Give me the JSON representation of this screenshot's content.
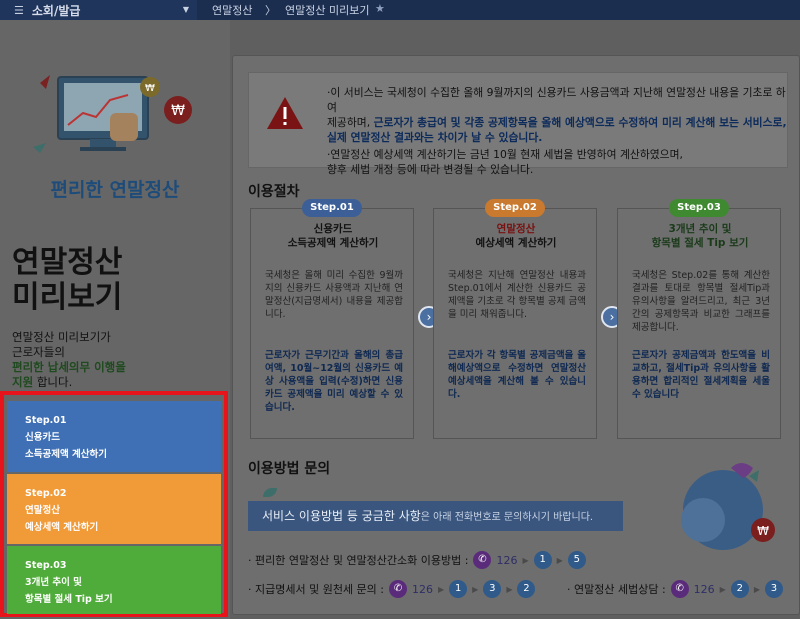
{
  "topbar": {
    "menu_icon": "hamburger-icon",
    "menu_label": "소회/발급",
    "breadcrumb": [
      "연말정산",
      "연말정산 미리보기"
    ],
    "favorite_icon": "star-icon"
  },
  "left": {
    "brand": "편리한 연말정산",
    "title_line1": "연말정산",
    "title_line2": "미리보기",
    "desc_line1": "연말정산 미리보기가",
    "desc_line2": "근로자들의",
    "desc_em": "편리한 납세의무 이행을",
    "desc_line4": "지원",
    "desc_line4_suffix": "합니다.",
    "steps": [
      {
        "label": "Step.01",
        "line1": "신용카드",
        "line2": "소득공제액 계산하기",
        "color": "#3f6fb4"
      },
      {
        "label": "Step.02",
        "line1": "연말정산",
        "line2": "예상세액 계산하기",
        "color": "#f19a38"
      },
      {
        "label": "Step.03",
        "line1": "3개년 추이 및",
        "line2": "항목별 절세 Tip 보기",
        "color": "#4fab3a"
      }
    ]
  },
  "notice": {
    "line1": "·이 서비스는 국세청이 수집한 올해 9월까지의 신용카드 사용금액과 지난해 연말정산 내용을 기초로 하여",
    "line2a": "제공하며, ",
    "line2b": "근로자가 총급여 및 각종 공제항목을 올해 예상액으로 수정하여 미리 계산해 보는 서비스로,",
    "line3": "실제 연말정산 결과와는 차이가 날 수 있습니다.",
    "line4": "·연말정산 예상세액 계산하기는 금년 10월 현재 세법을 반영하여 계산하였으며,",
    "line5": "향후 세법 개정 등에 따라 변경될 수 있습니다."
  },
  "procedure": {
    "title": "이용절차",
    "cards": [
      {
        "pill": "Step.01",
        "pill_color": "#3b5f96",
        "title1": "신용카드",
        "title2": "소득공제액 계산하기",
        "body": "국세청은 올해 미리 수집한 9월까지의 신용카드 사용액과 지난해 연말정산(지급명세서) 내용을 제공합니다.",
        "note": "근로자가 근무기간과 올해의 총급여액, 10월~12월의 신용카드 예상 사용액을 입력(수정)하면 신용카드 공제액을 미리 예상할 수 있습니다."
      },
      {
        "pill": "Step.02",
        "pill_color": "#c97a2e",
        "title1": "연말정산",
        "title2": "예상세액 계산하기",
        "body": "국세청은 지난해 연말정산 내용과 Step.01에서 계산한 신용카드 공제액을 기초로 각 항목별 공제 금액을 미리 채워줍니다.",
        "note": "근로자가 각 항목별 공제금액을 올해예상액으로 수정하면 연말정산 예상세액을 계산해 볼 수 있습니다."
      },
      {
        "pill": "Step.03",
        "pill_color": "#3f8a30",
        "title1": "3개년 추이 및",
        "title2": "항목별 절세 Tip 보기",
        "body": "국세청은 Step.02를 통해 계산한 결과를 토대로 항목별 절세Tip과 유의사항을 알려드리고, 최근 3년간의 공제항목과 비교한 그래프를 제공합니다.",
        "note": "근로자가 공제금액과 한도액을 비교하고, 절세Tip과 유의사항을 활용하면 합리적인 절세계획을 세울 수 있습니다"
      }
    ]
  },
  "inquiry": {
    "title": "이용방법 문의",
    "banner_main": "서비스 이용방법 등 궁금한 사항",
    "banner_sub": "은 아래 전화번호로 문의하시기 바랍니다.",
    "row1_label": "· 편리한 연말정산 및 연말정산간소화 이용방법 :",
    "row1_numbers": [
      "126",
      "1",
      "5"
    ],
    "row2_label": "· 지급명세서 및 원천세 문의 :",
    "row2_numbers": [
      "126",
      "1",
      "3",
      "2"
    ],
    "row3_label": "· 연말정산 세법상담 :",
    "row3_numbers": [
      "126",
      "2",
      "3"
    ]
  }
}
